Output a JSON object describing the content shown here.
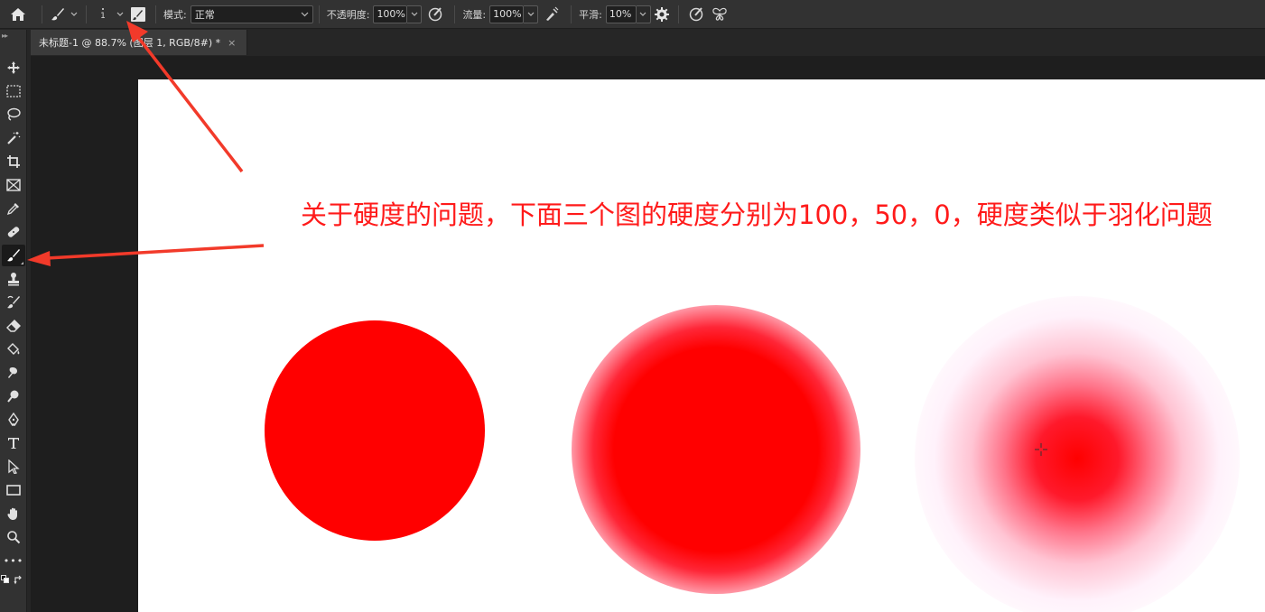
{
  "options_bar": {
    "brush_size": "1",
    "mode_label": "模式:",
    "mode_value": "正常",
    "opacity_label": "不透明度:",
    "opacity_value": "100%",
    "flow_label": "流量:",
    "flow_value": "100%",
    "smoothing_label": "平滑:",
    "smoothing_value": "10%"
  },
  "document_tab": {
    "title": "未标题-1 @ 88.7% (图层 1, RGB/8#) *",
    "close": "×"
  },
  "toolbar": {
    "tools": [
      "move-tool",
      "marquee-tool",
      "lasso-tool",
      "magic-wand-tool",
      "crop-tool",
      "frame-tool",
      "eyedropper-tool",
      "healing-brush-tool",
      "brush-tool",
      "clone-stamp-tool",
      "history-brush-tool",
      "eraser-tool",
      "paint-bucket-tool",
      "blur-tool",
      "dodge-tool",
      "pen-tool",
      "type-tool",
      "path-selection-tool",
      "rectangle-tool",
      "hand-tool",
      "zoom-tool",
      "more-tools"
    ],
    "active_tool": "brush-tool",
    "more_label": "•••",
    "foreground_color": "#ff0000",
    "background_color": "#ffffff"
  },
  "canvas": {
    "annotation": "关于硬度的问题，下面三个图的硬度分别为100，50，0，硬度类似于羽化问题",
    "annotation_color": "#ff1a1a",
    "brush_color": "#ff0000",
    "samples": [
      {
        "hardness": 100
      },
      {
        "hardness": 50
      },
      {
        "hardness": 0
      }
    ]
  },
  "colors": {
    "arrow": "#f23a2a",
    "options_bg": "#323232",
    "pasteboard": "#1e1e1e"
  }
}
